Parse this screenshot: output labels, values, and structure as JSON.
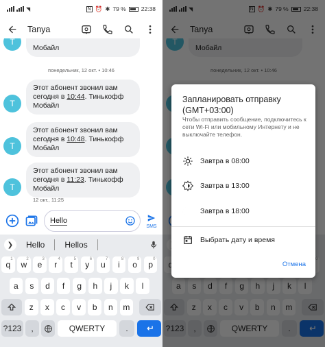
{
  "status": {
    "left_text": "",
    "battery": "79 %",
    "time": "22:38"
  },
  "topbar": {
    "contact_name": "Tanya"
  },
  "messages": {
    "prev_bubble_text": "Мобайл",
    "date_separator": "понедельник, 12 окт. • 10:46",
    "items": [
      {
        "line1": "Этот абонент звонил вам",
        "pre": "сегодня в ",
        "time": "10:44",
        "post": ". Тинькофф",
        "line3": "Мобайл"
      },
      {
        "line1": "Этот абонент звонил вам",
        "pre": "сегодня в ",
        "time": "10:48",
        "post": ". Тинькофф",
        "line3": "Мобайл"
      },
      {
        "line1": "Этот абонент звонил вам",
        "pre": "сегодня в ",
        "time": "11:23",
        "post": ". Тинькофф",
        "line3": "Мобайл"
      }
    ],
    "avatar_letter": "T",
    "last_timestamp": "12 окт., 11:25"
  },
  "compose": {
    "text": "Hello",
    "send_label": "SMS"
  },
  "keyboard": {
    "suggestions": [
      "Hello",
      "Hellos"
    ],
    "row1": [
      "q",
      "w",
      "e",
      "r",
      "t",
      "y",
      "u",
      "i",
      "o",
      "p"
    ],
    "row1_hints": [
      "1",
      "2",
      "3",
      "4",
      "5",
      "6",
      "7",
      "8",
      "9",
      "0"
    ],
    "row2": [
      "a",
      "s",
      "d",
      "f",
      "g",
      "h",
      "j",
      "k",
      "l"
    ],
    "row3": [
      "z",
      "x",
      "c",
      "v",
      "b",
      "n",
      "m"
    ],
    "numbers_key": "?123",
    "comma_key": ",",
    "space_key": "QWERTY",
    "period_key": "."
  },
  "dialog": {
    "title": "Запланировать отправку (GMT+03:00)",
    "subtitle": "Чтобы отправить сообщение, подключитесь к сети Wi-Fi или мобильному Интернету и не выключайте телефон.",
    "options": [
      {
        "label": "Завтра в 08:00",
        "icon": "sun-icon"
      },
      {
        "label": "Завтра в 13:00",
        "icon": "sun-bright-icon"
      },
      {
        "label": "Завтра в 18:00",
        "icon": "moon-icon"
      },
      {
        "label": "Выбрать дату и время",
        "icon": "calendar-icon"
      }
    ],
    "cancel_label": "Отмена"
  },
  "colors": {
    "accent": "#1a73e8",
    "avatar": "#4ec2dc",
    "bubble": "#eff0f2",
    "keyboard_bg": "#e9ebee"
  }
}
